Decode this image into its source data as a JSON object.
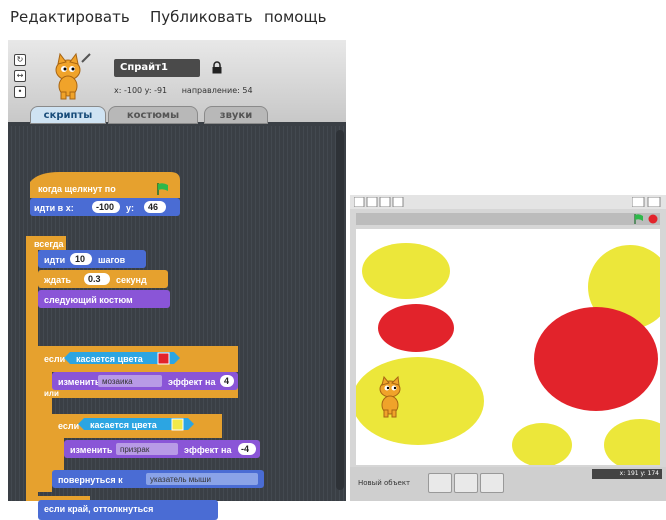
{
  "menu": {
    "items": [
      "Редактировать",
      "Публиковать",
      "помощь"
    ]
  },
  "sprite": {
    "name": "Спрайт1",
    "coords": "x: -100 y: -91",
    "direction_label": "направление:",
    "direction_value": "54"
  },
  "tabs": [
    "скрипты",
    "костюмы",
    "звуки"
  ],
  "script": {
    "hat": "когда щелкнут по",
    "goto": {
      "label": "идти в x:",
      "x": "-100",
      "y_label": "y:",
      "y": "46"
    },
    "forever": "всегда",
    "move": {
      "label": "идти",
      "value": "10",
      "suffix": "шагов"
    },
    "wait": {
      "label": "ждать",
      "value": "0.3",
      "suffix": "секунд"
    },
    "next_costume": "следующий костюм",
    "if1": {
      "label": "если",
      "sensing": "касается цвета",
      "color": "#e2232b"
    },
    "change1": {
      "label": "изменить",
      "dropdown": "мозаика",
      "suffix": "эффект на",
      "value": "4"
    },
    "else": "или",
    "if2": {
      "label": "если",
      "sensing": "касается цвета",
      "color": "#f0e94a"
    },
    "change2": {
      "label": "изменить",
      "dropdown": "призрак",
      "suffix": "эффект на",
      "value": "-4"
    },
    "point": {
      "label": "повернуться к",
      "dropdown": "указатель мыши"
    },
    "bounce": "если край, оттолкнуться"
  },
  "stage": {
    "new_sprite_label": "Новый объект",
    "mouse": "x: 191   y: 174"
  },
  "colors": {
    "control": "#e6a12e",
    "motion": "#4a6cd4",
    "looks": "#8a55d7",
    "sensing": "#2ca5e2",
    "red": "#e2232b",
    "yellow": "#ece73a",
    "green_flag": "#2fb84a"
  }
}
